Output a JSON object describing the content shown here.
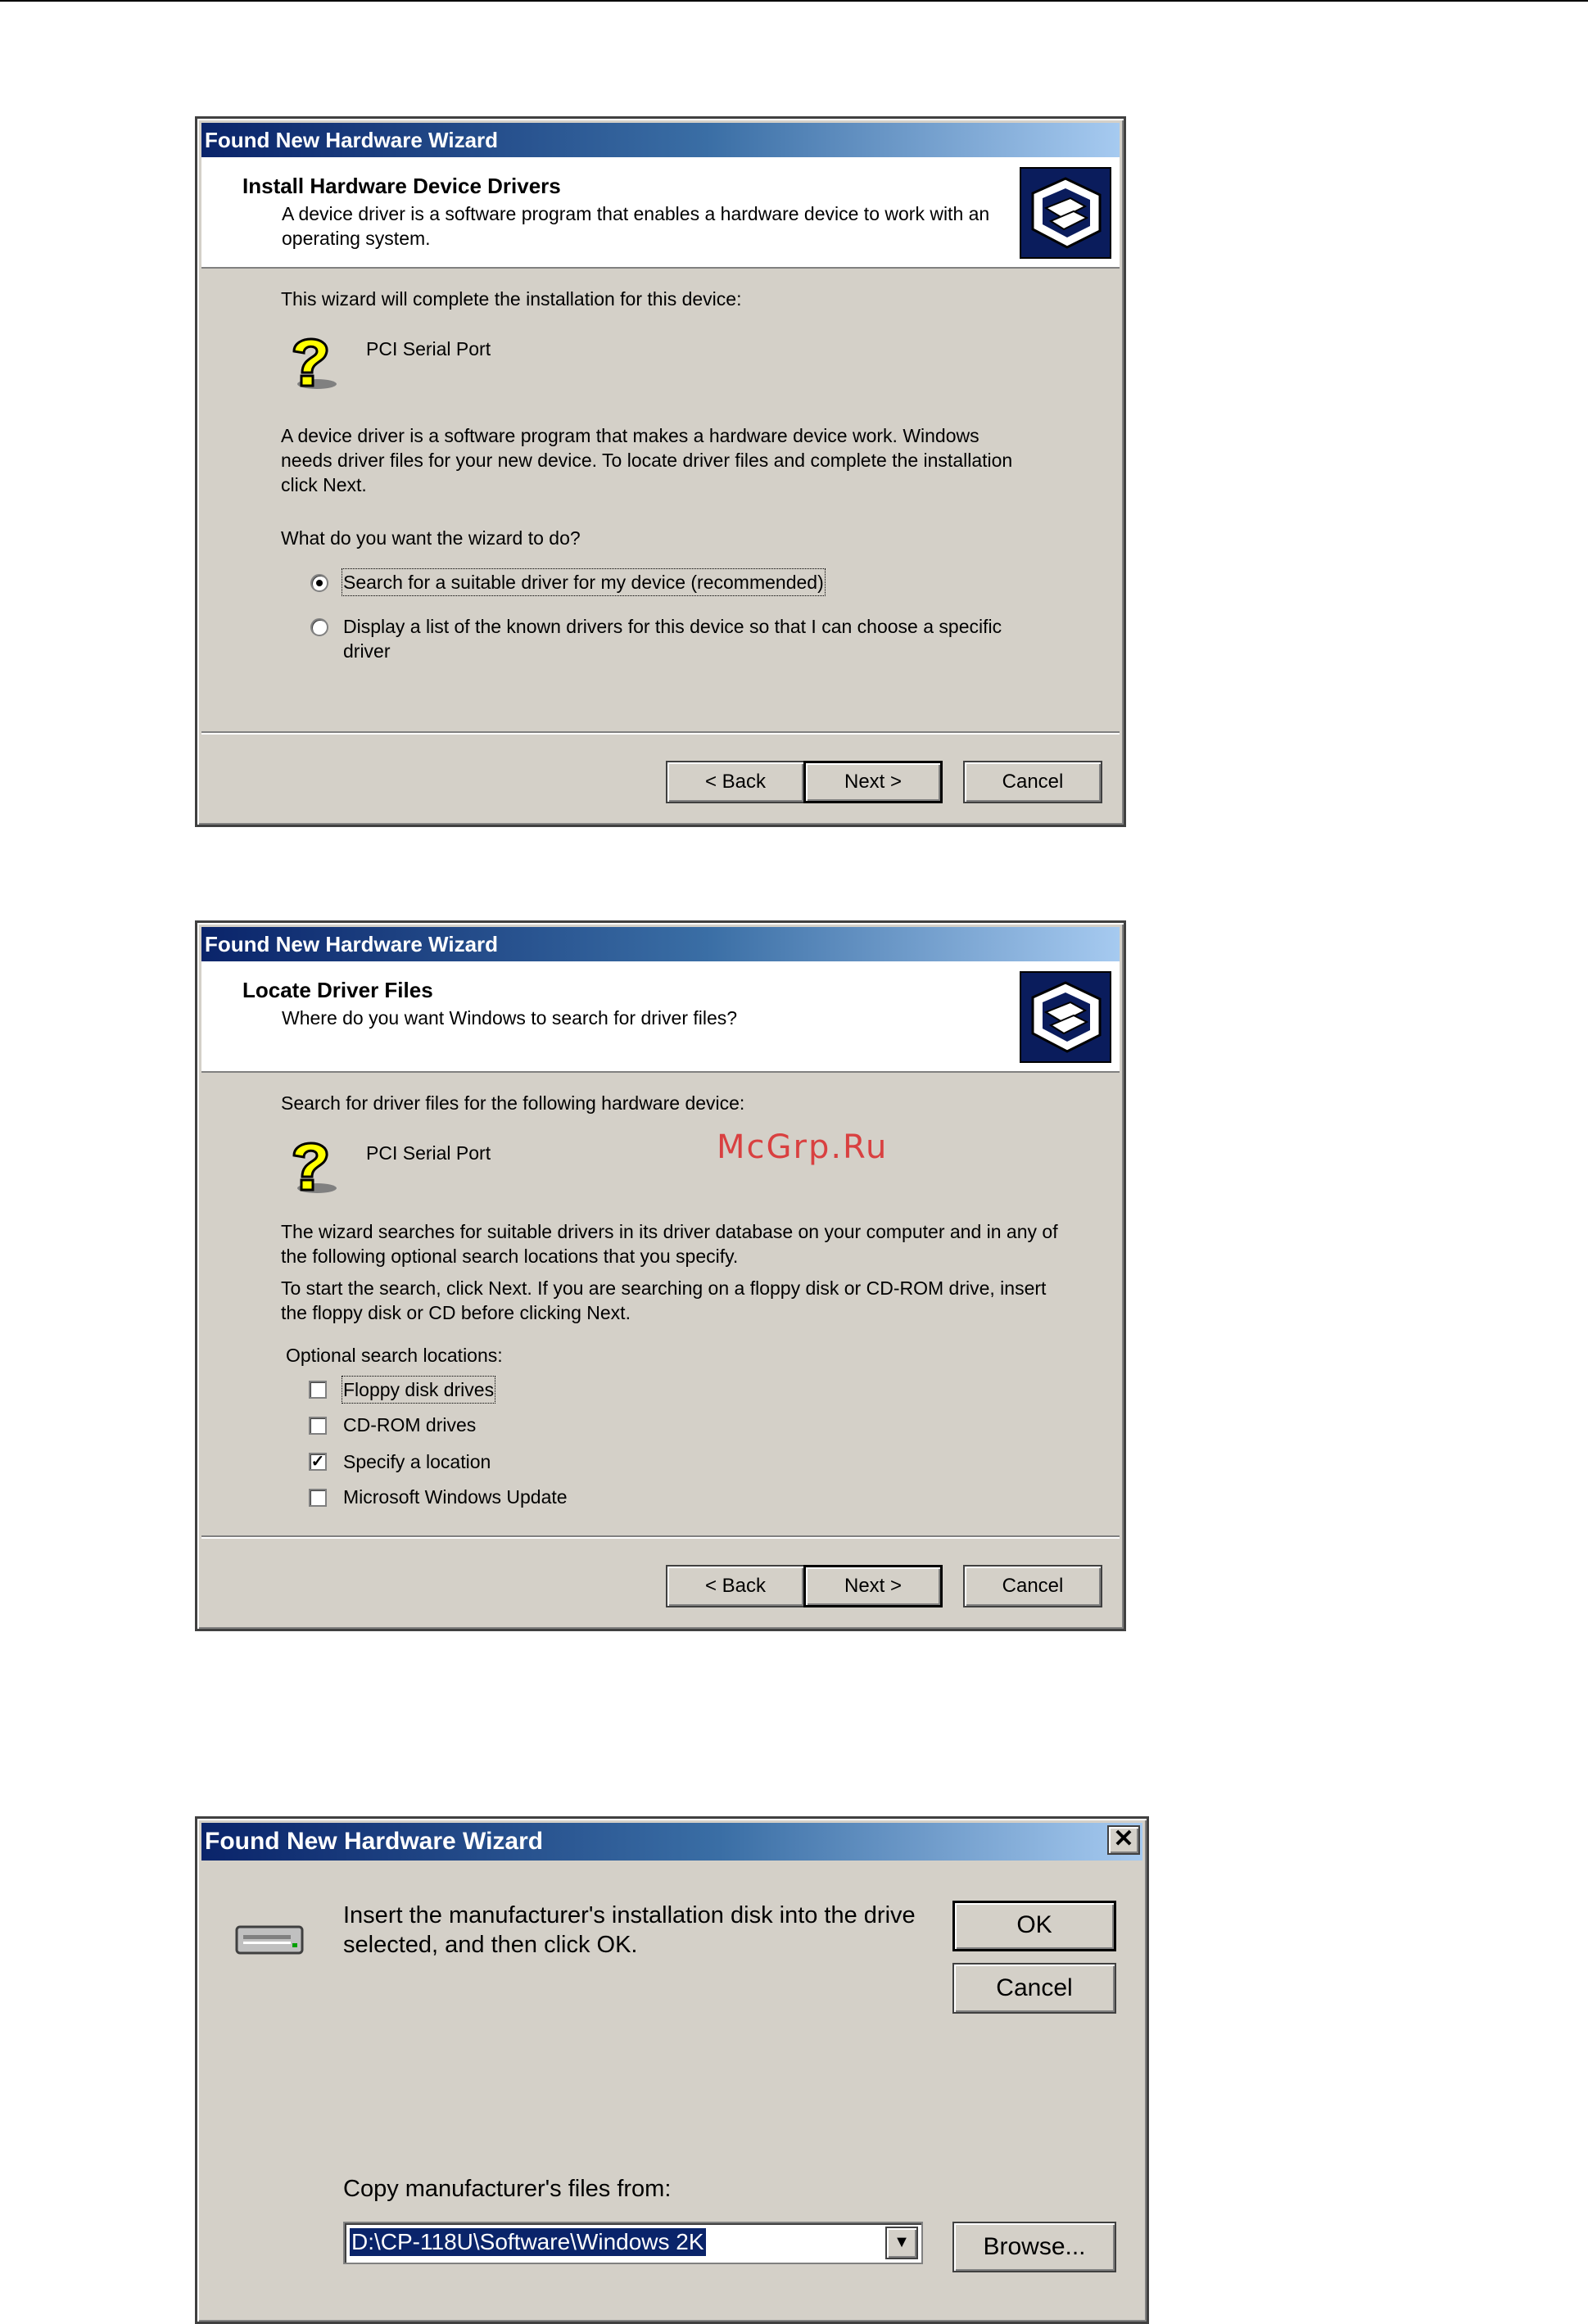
{
  "dialog1": {
    "title": "Found New Hardware Wizard",
    "header_title": "Install Hardware Device Drivers",
    "header_sub": "A device driver is a software program that enables a hardware device to work with an operating system.",
    "intro": "This wizard will complete the installation for this device:",
    "device_name": "PCI Serial Port",
    "description": "A device driver is a software program that makes a hardware device work. Windows needs driver files for your new device. To locate driver files and complete the installation click Next.",
    "question": "What do you want the wizard to do?",
    "options": [
      {
        "label": "Search for a suitable driver for my device (recommended)",
        "checked": true
      },
      {
        "label": "Display a list of the known drivers for this device so that I can choose a specific driver",
        "checked": false
      }
    ],
    "buttons": {
      "back": "< Back",
      "next": "Next >",
      "cancel": "Cancel"
    }
  },
  "dialog2": {
    "title": "Found New Hardware Wizard",
    "header_title": "Locate Driver Files",
    "header_sub": "Where do you want Windows to search for driver files?",
    "intro": "Search for driver files for the following hardware device:",
    "device_name": "PCI Serial Port",
    "paragraph1": "The wizard searches for suitable drivers in its driver database on your computer and in any of the following optional search locations that you specify.",
    "paragraph2": "To start the search, click Next. If you are searching on a floppy disk or CD-ROM drive, insert the floppy disk or CD before clicking Next.",
    "optional_label": "Optional search locations:",
    "checkboxes": [
      {
        "label": "Floppy disk drives",
        "checked": false
      },
      {
        "label": "CD-ROM drives",
        "checked": false
      },
      {
        "label": "Specify a location",
        "checked": true
      },
      {
        "label": "Microsoft Windows Update",
        "checked": false
      }
    ],
    "buttons": {
      "back": "< Back",
      "next": "Next >",
      "cancel": "Cancel"
    }
  },
  "watermark": "McGrp.Ru",
  "dialog3": {
    "title": "Found New Hardware Wizard",
    "message": "Insert the manufacturer's installation disk into the drive selected, and then click OK.",
    "ok": "OK",
    "cancel": "Cancel",
    "copy_label": "Copy manufacturer's files from:",
    "path": "D:\\CP-118U\\Software\\Windows 2K",
    "browse": "Browse..."
  },
  "icons": {
    "close": "close-icon",
    "question": "question-mark-icon",
    "hardware": "hardware-icon",
    "drive": "drive-icon",
    "dropdown": "chevron-down-icon"
  }
}
